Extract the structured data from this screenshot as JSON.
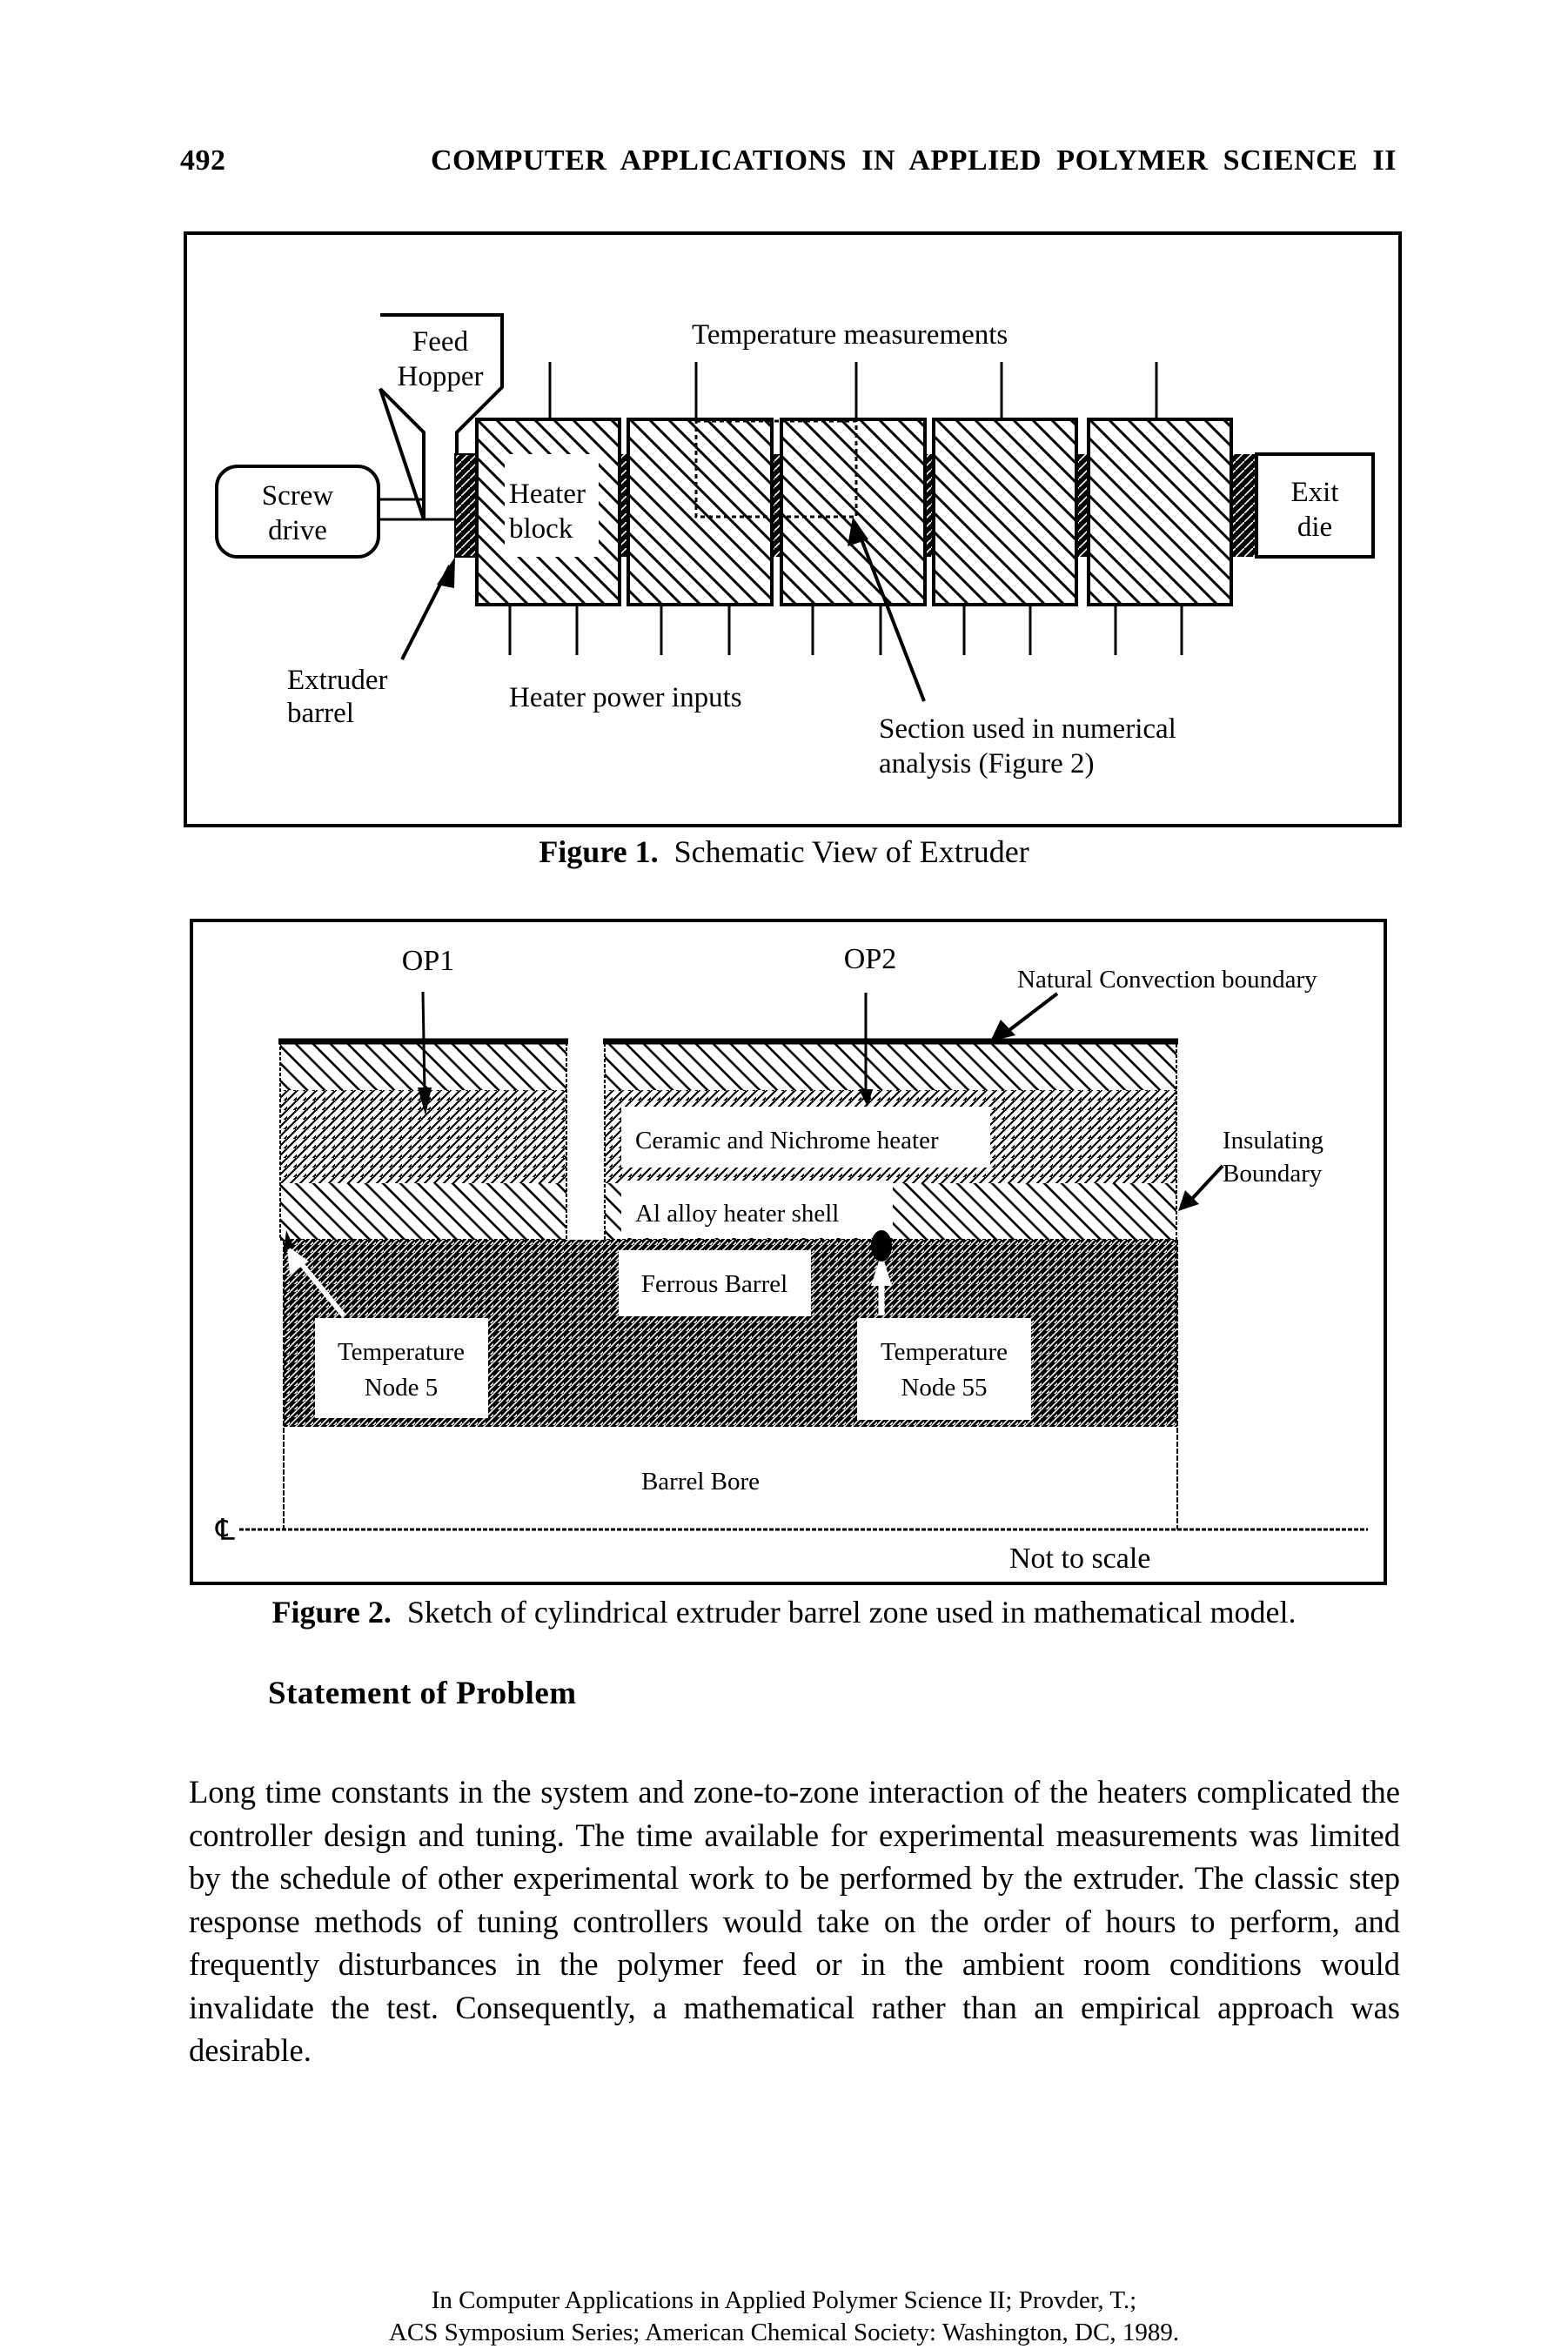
{
  "header": {
    "page_number": "492",
    "running_title": "COMPUTER APPLICATIONS IN APPLIED POLYMER SCIENCE II"
  },
  "figure1": {
    "labels": {
      "feed_hopper": [
        "Feed",
        "Hopper"
      ],
      "screw_drive": [
        "Screw",
        "drive"
      ],
      "heater_block": [
        "Heater",
        "block"
      ],
      "exit_die": [
        "Exit",
        "die"
      ],
      "temperature_measurements": "Temperature measurements",
      "extruder_barrel": [
        "Extruder",
        "barrel"
      ],
      "heater_power_inputs": "Heater power inputs",
      "section_used": [
        "Section used in numerical",
        "analysis (Figure 2)"
      ]
    },
    "heater_block_count": 5,
    "caption_label": "Figure 1.",
    "caption_text": "Schematic View of Extruder"
  },
  "figure2": {
    "labels": {
      "op1": "OP1",
      "op2": "OP2",
      "natural_convection": "Natural Convection boundary",
      "insulating_boundary": [
        "Insulating",
        "Boundary"
      ],
      "ceramic_heater": "Ceramic and Nichrome heater",
      "al_shell": "Al alloy heater shell",
      "ferrous_barrel": "Ferrous Barrel",
      "node5": [
        "Temperature",
        "Node 5"
      ],
      "node55": [
        "Temperature",
        "Node 55"
      ],
      "barrel_bore": "Barrel Bore",
      "centerline": "℄",
      "not_to_scale": "Not to scale"
    },
    "caption_label": "Figure 2.",
    "caption_text": "Sketch of cylindrical extruder barrel zone used in mathematical model."
  },
  "section": {
    "heading": "Statement of Problem",
    "paragraph": "Long time constants in the system and zone-to-zone interaction of the heaters complicated the controller design and tuning.  The time available for experimental measurements was limited by the schedule of other experimental work to be performed by the extruder.  The classic step response methods of tuning controllers would take on the order of hours to perform, and frequently disturbances in the polymer feed or in the ambient room conditions would invalidate the test.  Consequently, a mathematical rather than an empirical approach was desirable."
  },
  "footer": {
    "line1": "In Computer Applications in Applied Polymer Science II; Provder, T.;",
    "line2": "ACS Symposium Series; American Chemical Society: Washington, DC, 1989."
  }
}
